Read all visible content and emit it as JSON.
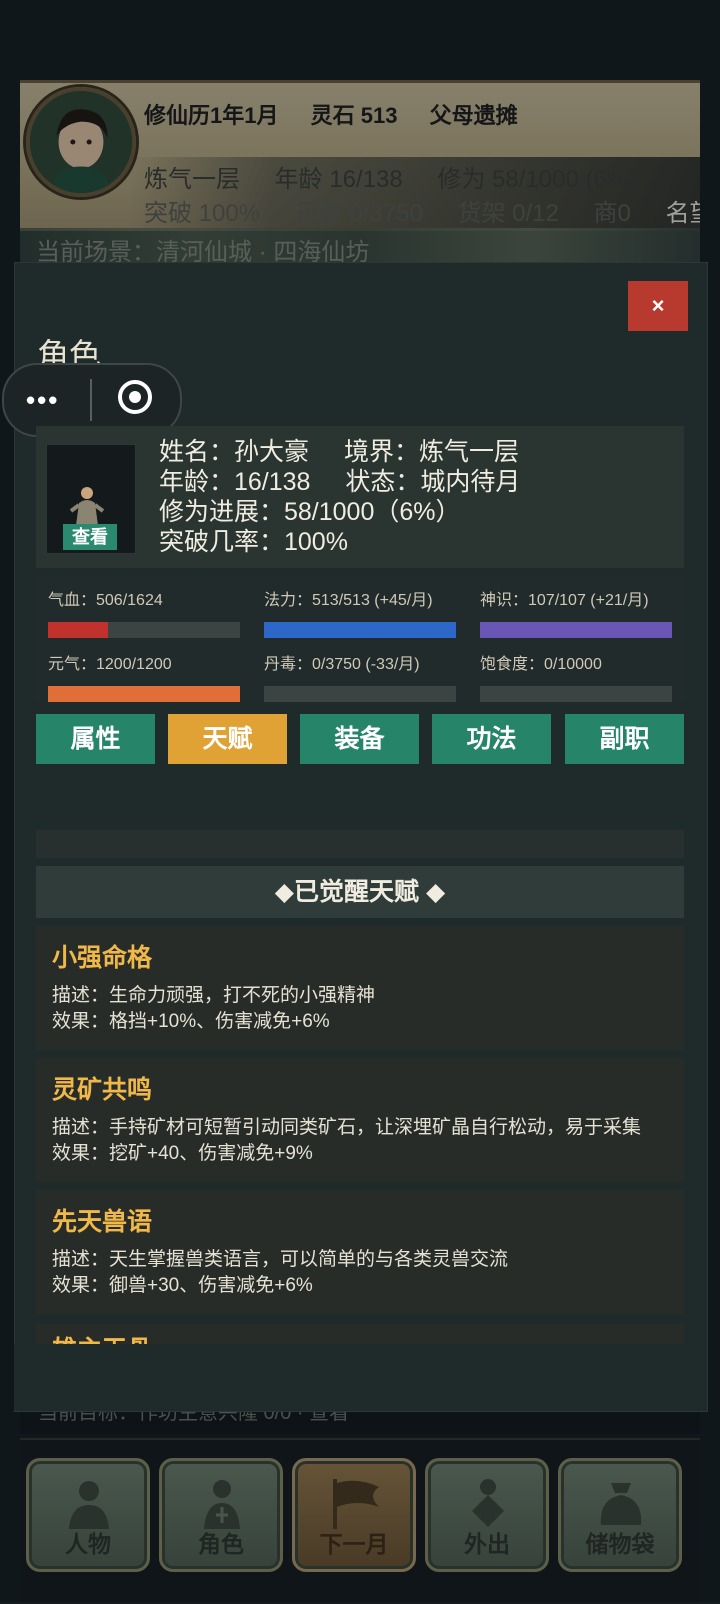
{
  "header": {
    "date": "修仙历1年1月",
    "spirit_stones": "灵石 513",
    "event": "父母遗摊",
    "realm": "炼气一层",
    "age": "年龄 16/138",
    "cultivation": "修为 58/1000 (6%)",
    "breakthrough": "突破 100%",
    "pill_toxin": "丹毒 0/3750",
    "shelf": "货架 0/12",
    "merchant": "商0",
    "fame": "名望"
  },
  "scene": {
    "text": "当前场景：清河仙城 · 四海仙坊"
  },
  "bottom_status": {
    "text": "当前目标：作坊生意兴隆 0/0 · 查看"
  },
  "modal": {
    "title": "角色",
    "close_label": "×",
    "capsule": {
      "more_label": "•••"
    },
    "character": {
      "view_label": "查看",
      "name_line": "姓名：孙大豪",
      "realm_line": "境界：炼气一层",
      "age_line": "年龄：16/138",
      "state_line": "状态：城内待月",
      "progress_line": "修为进展：58/1000（6%）",
      "breakthrough_line": "突破几率：100%"
    },
    "stats": [
      {
        "label": "气血：506/1624",
        "fill": 0.312,
        "color": "#c0322b"
      },
      {
        "label": "法力：513/513 (+45/月)",
        "fill": 1.0,
        "color": "#2d67c8"
      },
      {
        "label": "神识：107/107 (+21/月)",
        "fill": 1.0,
        "color": "#6a56b4"
      },
      {
        "label": "元气：1200/1200",
        "fill": 1.0,
        "color": "#e06e38"
      },
      {
        "label": "丹毒：0/3750 (-33/月)",
        "fill": 0.0,
        "color": "#8a8a8a"
      },
      {
        "label": "饱食度：0/10000",
        "fill": 0.0,
        "color": "#8a8a8a"
      }
    ],
    "tabs": [
      "属性",
      "天赋",
      "装备",
      "功法",
      "副职"
    ],
    "active_tab": "天赋",
    "section_title": "◆已觉醒天赋 ◆",
    "talents": [
      {
        "name": "小强命格",
        "desc": "描述：生命力顽强，打不死的小强精神",
        "effect": "效果：格挡+10%、伤害减免+6%"
      },
      {
        "name": "灵矿共鸣",
        "desc": "描述：手持矿材可短暂引动同类矿石，让深埋矿晶自行松动，易于采集",
        "effect": "效果：挖矿+40、伤害减免+9%"
      },
      {
        "name": "先天兽语",
        "desc": "描述：天生掌握兽类语言，可以简单的与各类灵兽交流",
        "effect": "效果：御兽+30、伤害减免+6%"
      }
    ],
    "talent_peek": "雄主天骨"
  },
  "nav": [
    "人物",
    "角色",
    "下一月",
    "外出",
    "储物袋"
  ]
}
